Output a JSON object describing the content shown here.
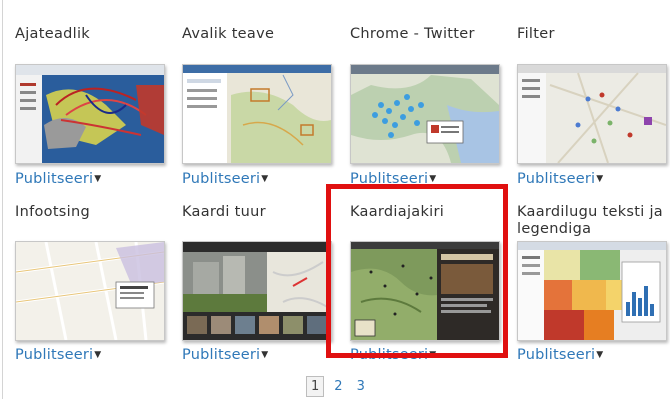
{
  "gallery": {
    "publish_label": "Publitseeri",
    "items": [
      {
        "title": "Ajateadlik"
      },
      {
        "title": "Avalik teave"
      },
      {
        "title": "Chrome - Twitter"
      },
      {
        "title": "Filter"
      },
      {
        "title": "Infootsing"
      },
      {
        "title": "Kaardi tuur"
      },
      {
        "title": "Kaardiajakiri"
      },
      {
        "title": "Kaardilugu teksti ja legendiga"
      }
    ]
  },
  "pagination": {
    "pages": [
      "1",
      "2",
      "3"
    ],
    "current": "1"
  },
  "colors": {
    "link": "#2f78b8",
    "highlight": "#e01010"
  }
}
